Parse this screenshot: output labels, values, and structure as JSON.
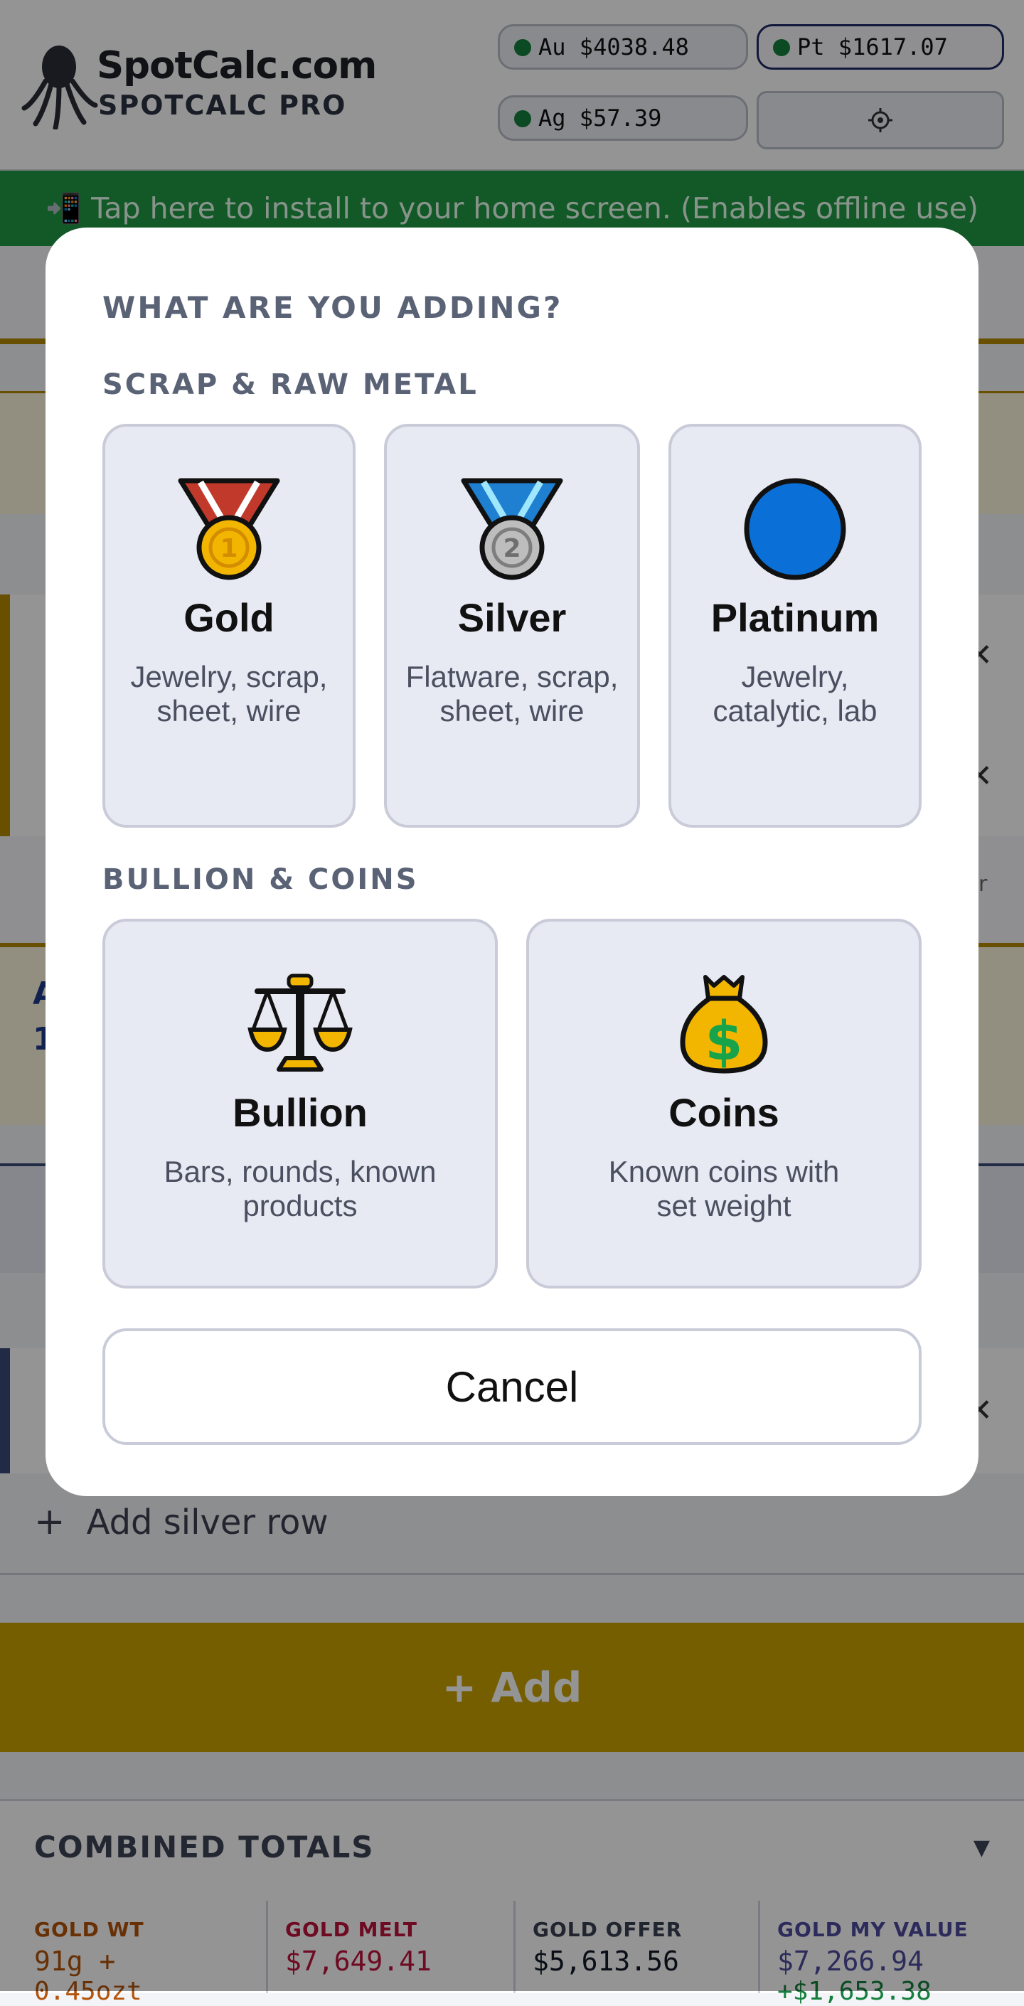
{
  "header": {
    "brand": "SpotCalc.com",
    "brand_sub": "SPOTCALC PRO",
    "prices": {
      "au": "Au $4038.48",
      "pt": "Pt $1617.07",
      "ag": "Ag $57.39"
    },
    "settings_icon": "gear-icon"
  },
  "install_banner": {
    "icon": "mobile-phone-icon",
    "text": "📲 Tap here to install to your home screen. (Enables offline use)"
  },
  "background": {
    "add_silver_label": "Add silver row",
    "add_button_label": "+ Add",
    "fragments": {
      "left_letter": "A",
      "left_digit": "1",
      "right_letter": "r"
    }
  },
  "totals": {
    "title": "COMBINED TOTALS",
    "columns": [
      {
        "label": "GOLD WT",
        "value": "91g +",
        "sub": "0.45ozt",
        "color": "#b45309"
      },
      {
        "label": "GOLD MELT",
        "value": "$7,649.41",
        "sub": "",
        "color": "#be123c"
      },
      {
        "label": "GOLD OFFER",
        "value": "$5,613.56",
        "sub": "",
        "color": "#374151"
      },
      {
        "label": "GOLD MY VALUE",
        "value": "$7,266.94",
        "sub": "+$1,653.38",
        "color": "#4c4a9e"
      }
    ]
  },
  "modal": {
    "title": "WHAT ARE YOU ADDING?",
    "sections": [
      {
        "label": "SCRAP & RAW METAL",
        "cards": [
          {
            "icon": "gold-medal-icon",
            "title": "Gold",
            "desc": "Jewelry, scrap, sheet, wire"
          },
          {
            "icon": "silver-medal-icon",
            "title": "Silver",
            "desc": "Flatware, scrap, sheet, wire"
          },
          {
            "icon": "blue-circle-icon",
            "title": "Platinum",
            "desc": "Jewelry, catalytic, lab"
          }
        ]
      },
      {
        "label": "BULLION & COINS",
        "cards": [
          {
            "icon": "balance-scale-icon",
            "title": "Bullion",
            "desc": "Bars, rounds, known products"
          },
          {
            "icon": "money-bag-icon",
            "title": "Coins",
            "desc": "Known coins with set weight"
          }
        ]
      }
    ],
    "cancel_label": "Cancel"
  },
  "colors": {
    "overlay": "rgba(0,0,0,0.42)",
    "install_banner": "#1f9a44",
    "add_bar": "#caa200",
    "platinum_circle": "#0a6fd6",
    "price_dot": "#15803d"
  }
}
